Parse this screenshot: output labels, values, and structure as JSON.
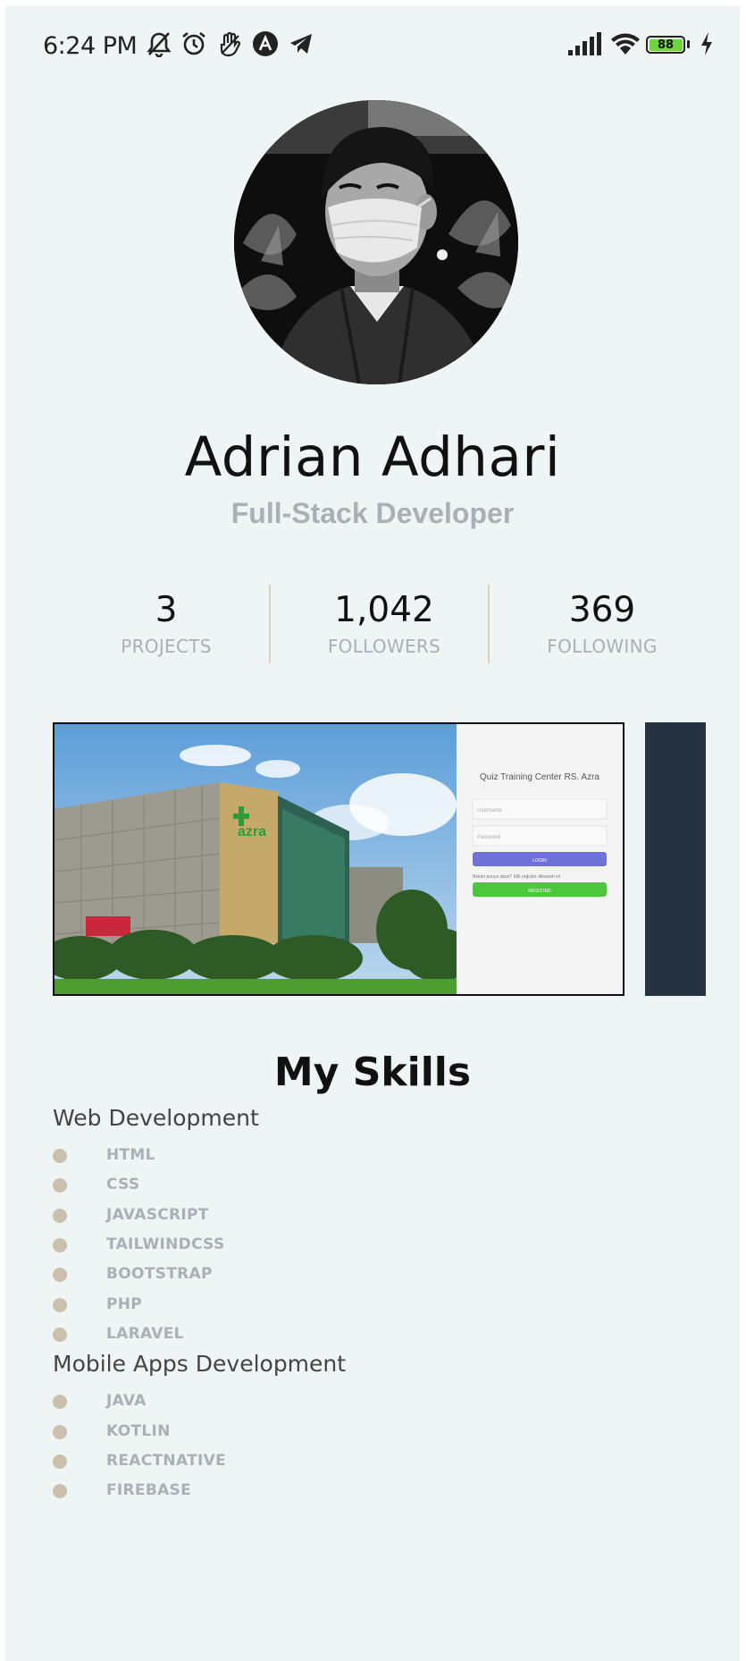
{
  "status_bar": {
    "time": "6:24 PM",
    "icons": [
      "bell-off-icon",
      "alarm-icon",
      "hand-icon",
      "app-a-icon",
      "telegram-icon"
    ],
    "right_icons": [
      "signal-icon",
      "wifi-icon",
      "battery-icon",
      "charging-icon"
    ],
    "battery_level": "88",
    "battery_color": "#6fd23e"
  },
  "profile": {
    "name": "Adrian Adhari",
    "role": "Full-Stack Developer"
  },
  "stats": [
    {
      "value": "3",
      "label": "PROJECTS"
    },
    {
      "value": "1,042",
      "label": "FOLLOWERS"
    },
    {
      "value": "369",
      "label": "FOLLOWING"
    }
  ],
  "projects": {
    "card1_title": "Quiz Training Center RS. Azra",
    "card1_username_placeholder": "Username",
    "card1_password_placeholder": "Password",
    "card1_login": "LOGIN",
    "card1_hint": "Belum punya akun? Klik register dibawah ini",
    "card1_register": "REGISTER",
    "card1_building_sign": "azra"
  },
  "skills": {
    "title": "My Skills",
    "groups": [
      {
        "title": "Web Development",
        "items": [
          "HTML",
          "CSS",
          "JAVASCRIPT",
          "TAILWINDCSS",
          "BOOTSTRAP",
          "PHP",
          "LARAVEL"
        ]
      },
      {
        "title": "Mobile Apps Development",
        "items": [
          "JAVA",
          "KOTLIN",
          "REACTNATIVE",
          "FIREBASE"
        ]
      }
    ]
  },
  "colors": {
    "background": "#eff4f4",
    "muted_text": "#a9b0b6",
    "bullet": "#cbbfae",
    "divider": "#ddd2c2",
    "next_card": "#263240",
    "login_button": "#6f73d8",
    "register_button": "#4cc63b"
  }
}
